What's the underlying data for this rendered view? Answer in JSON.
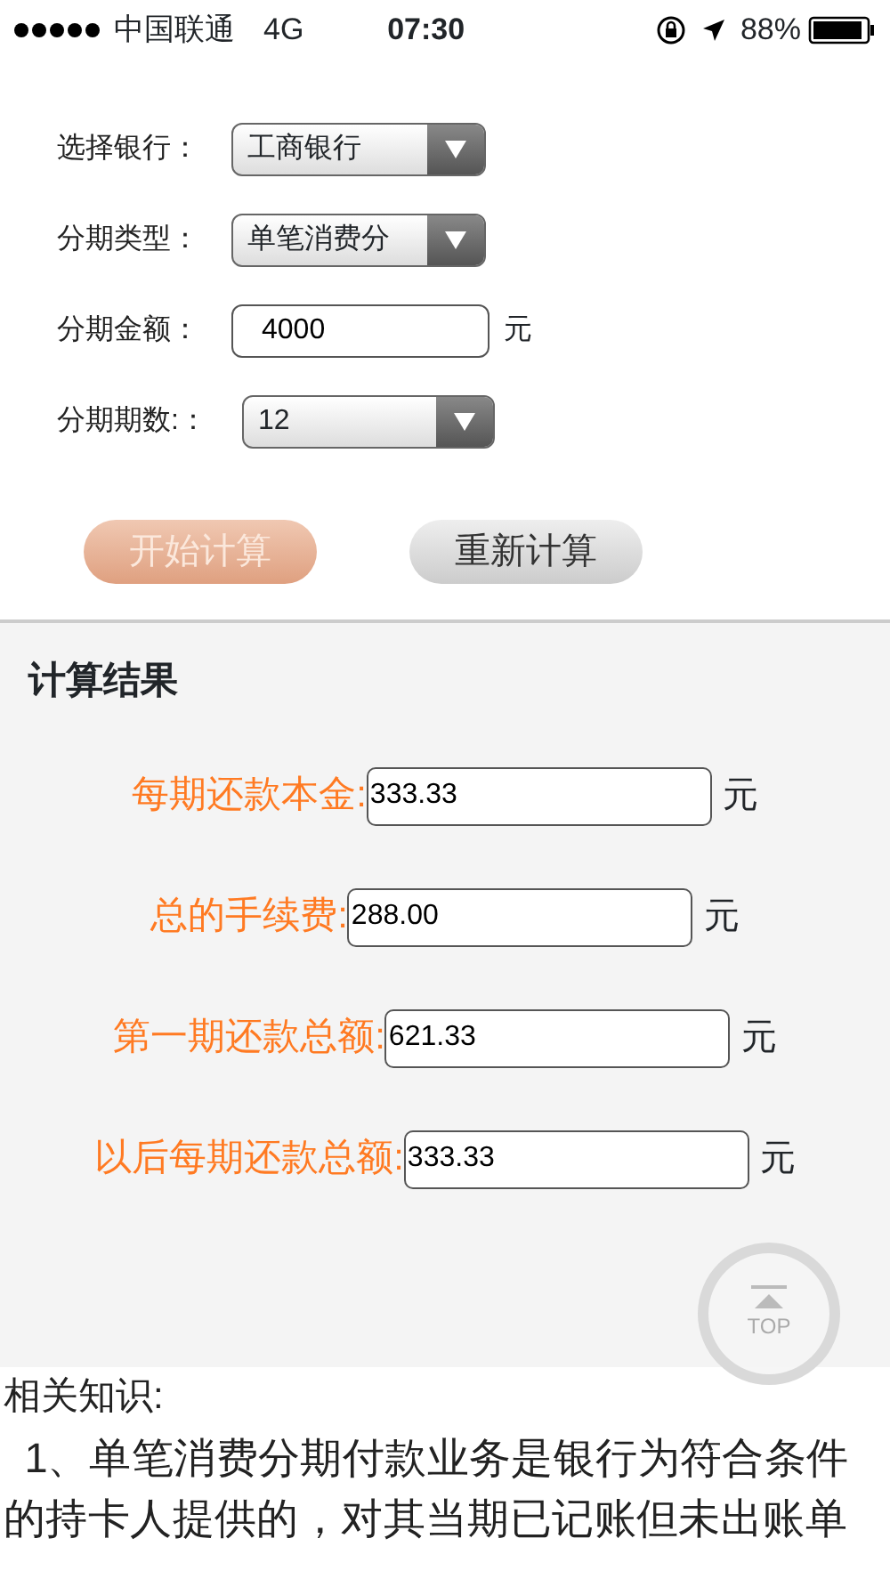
{
  "status_bar": {
    "carrier": "中国联通",
    "network": "4G",
    "time": "07:30",
    "battery": "88%"
  },
  "form": [
    {
      "kind": "select",
      "label": "选择银行：",
      "value": "工商银行"
    },
    {
      "kind": "select",
      "label": "分期类型：",
      "value": "单笔消费分"
    },
    {
      "kind": "input",
      "label": "分期金额：",
      "value": "4000",
      "unit": "元"
    },
    {
      "kind": "select",
      "label": "分期期数:：",
      "value": "12"
    }
  ],
  "buttons": [
    {
      "label": "开始计算",
      "kind": "primary"
    },
    {
      "label": "重新计算",
      "kind": "secondary"
    }
  ],
  "results": {
    "title": "计算结果",
    "rows": [
      {
        "label": "每期还款本金:",
        "value": "333.33",
        "unit": "元"
      },
      {
        "label": "总的手续费:",
        "value": "288.00",
        "unit": "元"
      },
      {
        "label": "第一期还款总额:",
        "value": "621.33",
        "unit": "元"
      },
      {
        "label": "以后每期还款总额:",
        "value": "333.33",
        "unit": "元"
      }
    ]
  },
  "top_button": {
    "label": "TOP"
  },
  "knowledge": {
    "title": "相关知识:",
    "paragraph": "1、单笔消费分期付款业务是银行为符合条件的持卡人提供的，对其当期已记账但未出账单"
  }
}
